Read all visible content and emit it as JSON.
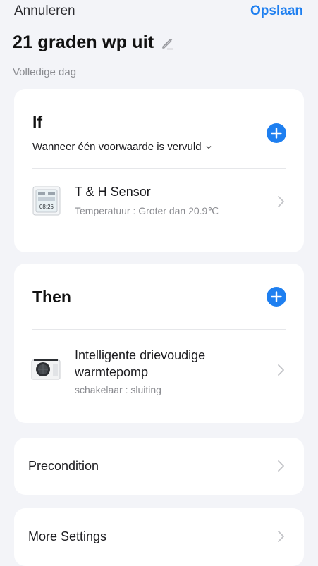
{
  "header": {
    "cancel_label": "Annuleren",
    "save_label": "Opslaan",
    "title": "21 graden wp uit",
    "subtitle": "Volledige dag"
  },
  "if_section": {
    "title": "If",
    "condition_mode": "Wanneer één voorwaarde is vervuld",
    "items": [
      {
        "name": "T & H Sensor",
        "detail": "Temperatuur : Groter dan 20.9℃",
        "thumb_text": "08:26"
      }
    ]
  },
  "then_section": {
    "title": "Then",
    "items": [
      {
        "name_line1": "Intelligente drievoudige",
        "name_line2": "warmtepomp",
        "detail": "schakelaar : sluiting"
      }
    ]
  },
  "precondition": {
    "label": "Precondition"
  },
  "more_settings": {
    "label": "More Settings"
  },
  "colors": {
    "accent": "#1e7ff0",
    "background": "#f3f4f8",
    "card": "#ffffff",
    "muted_text": "#8a8b90"
  },
  "icons": [
    "pencil-icon",
    "plus-icon",
    "chevron-down-icon",
    "chevron-right-icon",
    "sensor-device-icon",
    "heat-pump-device-icon"
  ]
}
